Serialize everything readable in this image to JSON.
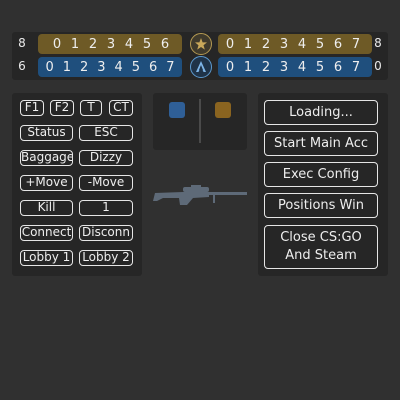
{
  "scoreboard": {
    "t_score": "8",
    "ct_score": "6",
    "right_top_score": "8",
    "right_bottom_score": "0",
    "left_top_rounds": [
      "0",
      "1",
      "2",
      "3",
      "4",
      "5",
      "6"
    ],
    "left_bottom_rounds": [
      "0",
      "1",
      "2",
      "3",
      "4",
      "5",
      "6",
      "7"
    ],
    "right_top_rounds": [
      "0",
      "1",
      "2",
      "3",
      "4",
      "5",
      "6",
      "7"
    ],
    "right_bottom_rounds": [
      "0",
      "1",
      "2",
      "3",
      "4",
      "5",
      "6",
      "7"
    ],
    "colors": {
      "t": "#6e5a26",
      "ct": "#1f4f7d"
    }
  },
  "keys": {
    "f1": "F1",
    "f2": "F2",
    "t": "T",
    "ct": "CT",
    "status": "Status",
    "esc": "ESC",
    "baggage": "Baggage",
    "dizzy": "Dizzy",
    "plus_move": "+Move",
    "minus_move": "-Move",
    "kill": "Kill",
    "count": "1",
    "connect": "Connect",
    "disconnect": "Disconn",
    "lobby1": "Lobby 1",
    "lobby2": "Lobby 2"
  },
  "actions": {
    "loading": "Loading...",
    "start_main": "Start Main Acc",
    "exec_config": "Exec Config",
    "positions_win": "Positions Win",
    "close_line1": "Close CS:GO",
    "close_line2": "And Steam"
  },
  "team_panel": {
    "ct_color": "#2f5f97",
    "t_color": "#8a6420"
  },
  "icons": {
    "t_emblem": "terrorist-emblem-icon",
    "ct_emblem": "counter-terrorist-emblem-icon",
    "weapon": "sniper-rifle-icon"
  }
}
